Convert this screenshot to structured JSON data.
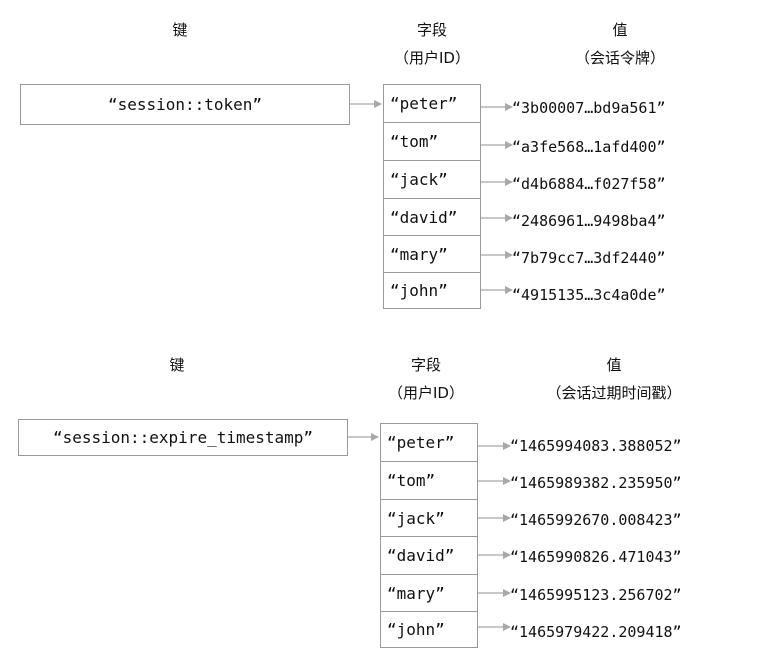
{
  "diagrams": [
    {
      "header_key": "键",
      "header_field_line1": "字段",
      "header_field_line2": "（用户ID）",
      "header_value_line1": "值",
      "header_value_line2": "（会话令牌）",
      "key": "“session::token”",
      "rows": [
        {
          "field": "“peter”",
          "value": "“3b00007…bd9a561”"
        },
        {
          "field": "“tom”",
          "value": "“a3fe568…1afd400”"
        },
        {
          "field": "“jack”",
          "value": "“d4b6884…f027f58”"
        },
        {
          "field": "“david”",
          "value": "“2486961…9498ba4”"
        },
        {
          "field": "“mary”",
          "value": "“7b79cc7…3df2440”"
        },
        {
          "field": "“john”",
          "value": "“4915135…3c4a0de”"
        }
      ]
    },
    {
      "header_key": "键",
      "header_field_line1": "字段",
      "header_field_line2": "（用户ID）",
      "header_value_line1": "值",
      "header_value_line2": "（会话过期时间戳）",
      "key": "“session::expire_timestamp”",
      "rows": [
        {
          "field": "“peter”",
          "value": "“1465994083.388052”"
        },
        {
          "field": "“tom”",
          "value": "“1465989382.235950”"
        },
        {
          "field": "“jack”",
          "value": "“1465992670.008423”"
        },
        {
          "field": "“david”",
          "value": "“1465990826.471043”"
        },
        {
          "field": "“mary”",
          "value": "“1465995123.256702”"
        },
        {
          "field": "“john”",
          "value": "“1465979422.209418”"
        }
      ]
    }
  ]
}
